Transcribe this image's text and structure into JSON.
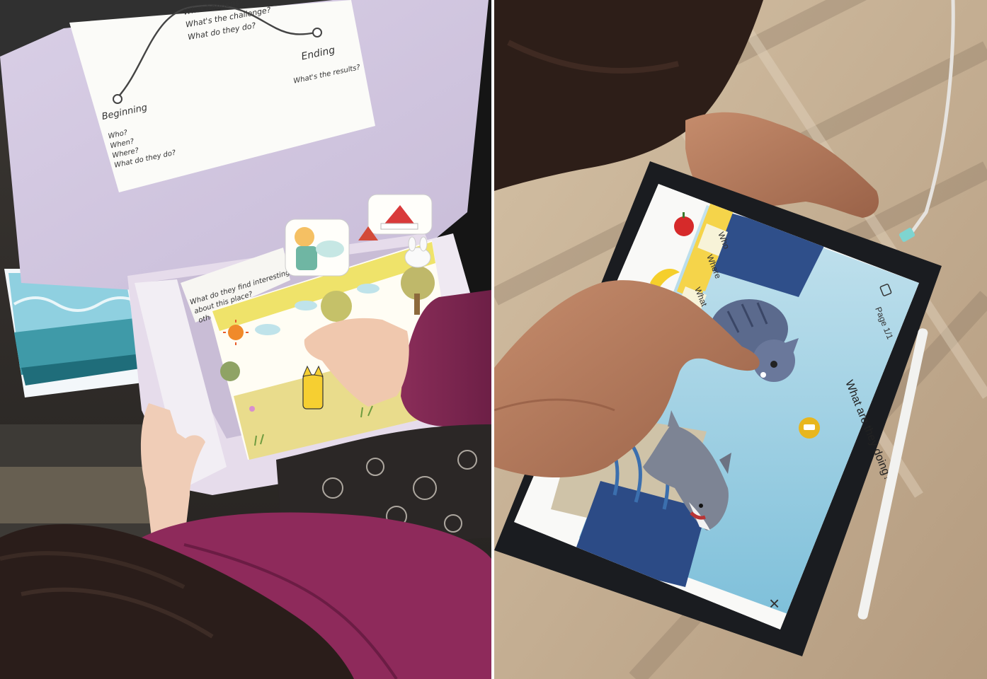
{
  "left_photo": {
    "story_sheet": {
      "top_prompts": [
        "What happens?",
        "What's the challenge?",
        "What do they do?"
      ],
      "beginning_label": "Beginning",
      "beginning_prompts": [
        "Who?",
        "When?",
        "Where?",
        "What do they do?"
      ],
      "ending_label": "Ending",
      "ending_prompt": "What's the results?"
    },
    "prompt_card": [
      "What do they find interesting",
      "about this place?",
      "other"
    ]
  },
  "right_photo": {
    "tablet": {
      "tabs": [
        "Who",
        "Where",
        "What"
      ],
      "page_label": "Page 1/1",
      "question": "What are they doing?",
      "close_symbol": "×"
    }
  }
}
